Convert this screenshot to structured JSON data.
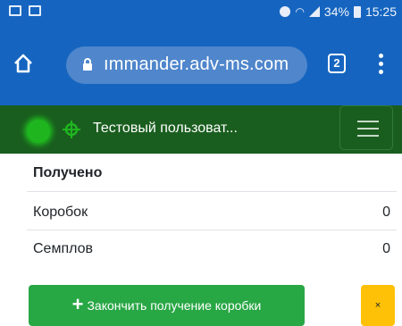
{
  "status_bar": {
    "battery_percent": "34%",
    "time": "15:25"
  },
  "browser": {
    "url": "ımmander.adv-ms.com",
    "tab_count": "2"
  },
  "app": {
    "user_name": "Тестовый пользоват...",
    "status_color": "#1fb51f",
    "header_color": "#1a5e1f"
  },
  "received": {
    "title": "Получено",
    "rows": [
      {
        "label": "Коробок",
        "value": "0"
      },
      {
        "label": "Семплов",
        "value": "0"
      }
    ]
  },
  "actions": {
    "finish_icon": "+",
    "finish_label": "Закончить получение коробки",
    "close_label": "×"
  }
}
